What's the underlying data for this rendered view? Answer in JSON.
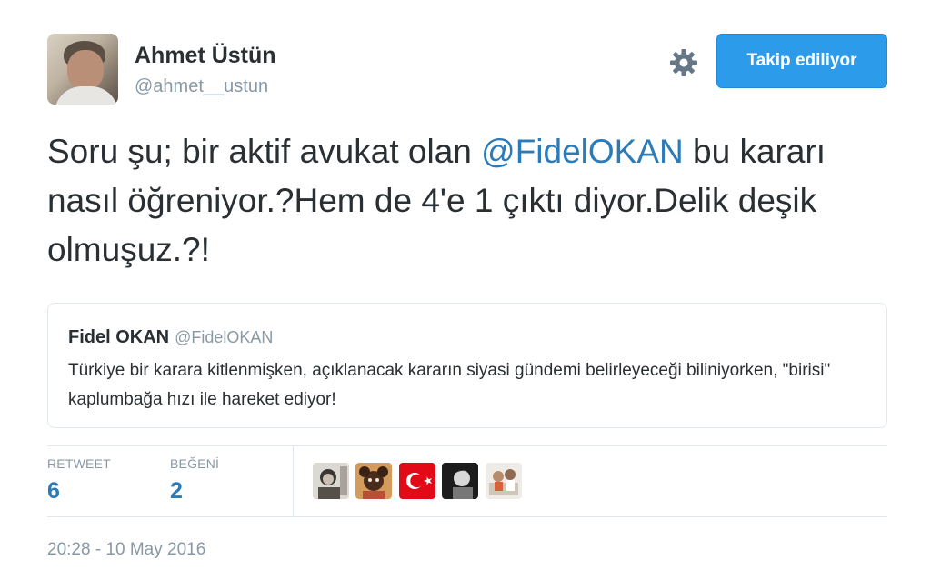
{
  "author": {
    "name": "Ahmet Üstün",
    "handle": "@ahmet__ustun",
    "avatar_icon": "user-avatar"
  },
  "actions": {
    "settings_icon": "gear-icon",
    "follow_label": "Takip ediliyor",
    "accent_color": "#2b9bea"
  },
  "tweet": {
    "text_before": "Soru şu; bir aktif avukat olan ",
    "mention": "@FidelOKAN",
    "text_after": " bu kararı nasıl öğreniyor.?Hem de 4'e 1 çıktı diyor.Delik deşik olmuşuz.?!"
  },
  "quoted_tweet": {
    "name": "Fidel OKAN",
    "handle": "@FidelOKAN",
    "text": "Türkiye bir karara kitlenmişken, açıklanacak kararın siyasi gündemi belirleyeceği biliniyorken, \"birisi\" kaplumbağa hızı ile hareket ediyor!"
  },
  "stats": {
    "retweet_label": "RETWEET",
    "retweet_count": "6",
    "like_label": "BEĞENİ",
    "like_count": "2"
  },
  "likers": [
    {
      "icon": "liker-avatar-1"
    },
    {
      "icon": "liker-avatar-2"
    },
    {
      "icon": "liker-avatar-3-turkish-flag"
    },
    {
      "icon": "liker-avatar-4"
    },
    {
      "icon": "liker-avatar-5"
    }
  ],
  "timestamp": "20:28 - 10 May 2016"
}
